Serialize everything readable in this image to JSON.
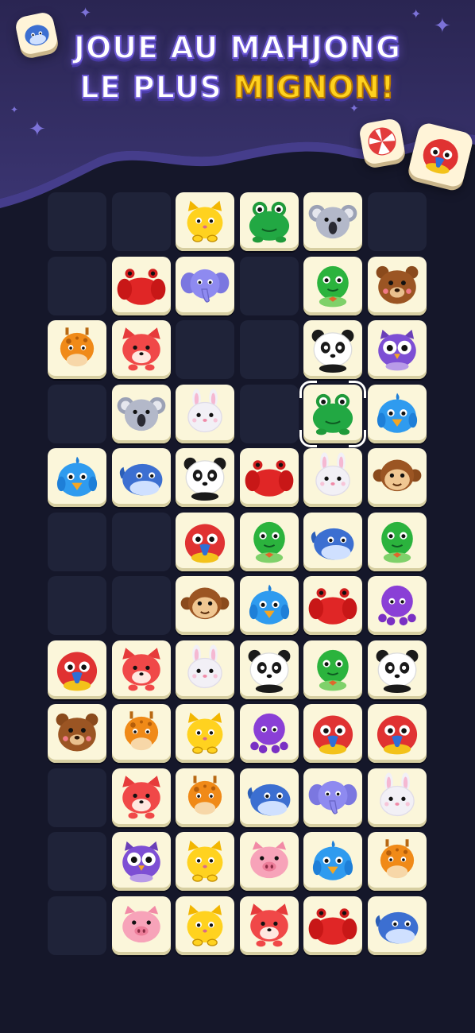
{
  "header": {
    "line1": "JOUE AU MAHJONG",
    "line2_prefix": "LE PLUS ",
    "line2_highlight": "MIGNON!",
    "highlight_color": "#ffd21f"
  },
  "decorations": {
    "top_left_tile": "whale",
    "right_tiles": [
      "peppermint-candy",
      "parrot"
    ]
  },
  "colors": {
    "background": "#15172a",
    "header_purple": "#3a3470",
    "tile_face": "#fbf6da",
    "empty_cell": "#1f2339"
  },
  "board": {
    "columns": 6,
    "rows": 12,
    "selected": {
      "row": 3,
      "col": 4
    },
    "grid": [
      [
        null,
        null,
        "cat",
        "frog",
        "koala",
        null
      ],
      [
        null,
        "crab",
        "elephant",
        null,
        "turtle",
        "bear"
      ],
      [
        "giraffe",
        "fox",
        null,
        null,
        "panda",
        "owl"
      ],
      [
        null,
        "koala",
        "rabbit",
        null,
        "frog",
        "bird"
      ],
      [
        "bird",
        "whale",
        "panda",
        "crab",
        "rabbit",
        "monkey"
      ],
      [
        null,
        null,
        "parrot",
        "turtle",
        "whale",
        "turtle"
      ],
      [
        null,
        null,
        "monkey",
        "bird",
        "crab",
        "octopus"
      ],
      [
        "parrot",
        "fox",
        "rabbit",
        "panda",
        "turtle",
        "panda"
      ],
      [
        "bear",
        "giraffe",
        "cat",
        "octopus",
        "parrot",
        "parrot"
      ],
      [
        null,
        "fox",
        "giraffe",
        "whale",
        "elephant",
        "rabbit"
      ],
      [
        null,
        "owl",
        "cat",
        "pig",
        "bird",
        "giraffe"
      ],
      [
        null,
        "pig",
        "cat",
        "fox",
        "crab",
        "whale"
      ]
    ]
  }
}
